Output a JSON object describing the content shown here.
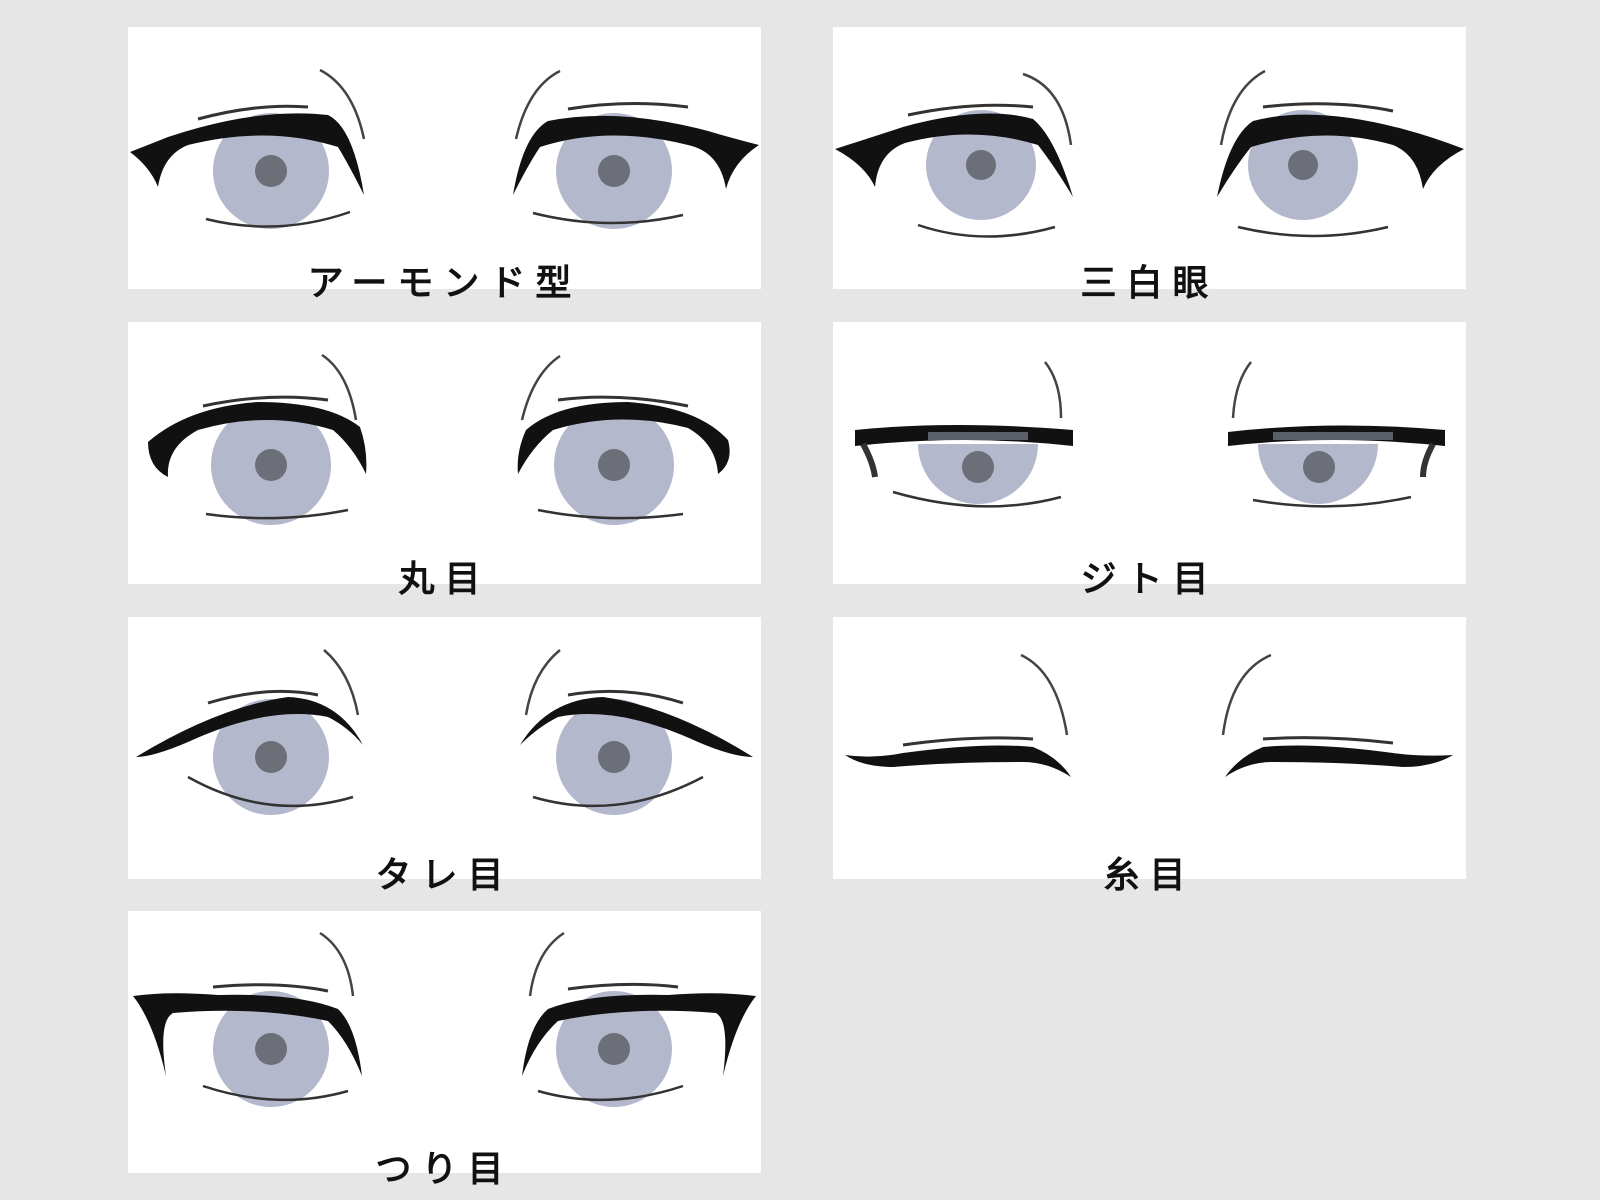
{
  "eye_types": [
    {
      "label": "アーモンド型"
    },
    {
      "label": "三白眼"
    },
    {
      "label": "丸目"
    },
    {
      "label": "ジト目"
    },
    {
      "label": "タレ目"
    },
    {
      "label": "糸目"
    },
    {
      "label": "つり目"
    }
  ],
  "colors": {
    "background": "#e6e6e6",
    "panel": "#ffffff",
    "iris": "#b3b8cc",
    "pupil": "#6c6e78",
    "lash": "#111111",
    "lid_shade": "#5a5e66"
  }
}
